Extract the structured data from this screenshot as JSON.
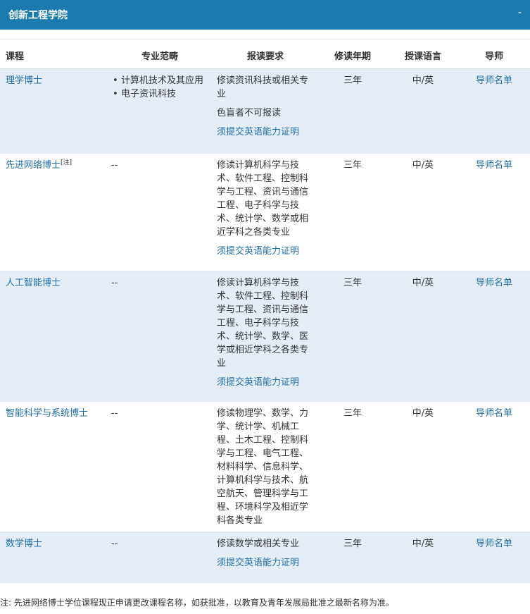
{
  "header": {
    "title": "创新工程学院",
    "toggle": "-"
  },
  "columns": [
    "课程",
    "专业范畴",
    "报读要求",
    "修读年期",
    "授课语言",
    "导师"
  ],
  "rows": [
    {
      "program": "理学博士",
      "note_mark": "",
      "fields": [
        "计算机技术及其应用",
        "电子资讯科技"
      ],
      "field_dash": "",
      "requirements": [
        "修读资讯科技或相关专业",
        "色盲者不可报读"
      ],
      "english_link": "须提交英语能力证明",
      "years": "三年",
      "language": "中/英",
      "supervisor": "导师名单"
    },
    {
      "program": "先进网络博士",
      "note_mark": "[注]",
      "fields": [],
      "field_dash": "--",
      "requirements": [
        "修读计算机科学与技术、软件工程、控制科学与工程、资讯与通信工程、电子科学与技术、统计学、数学或相近学科之各类专业"
      ],
      "english_link": "须提交英语能力证明",
      "years": "三年",
      "language": "中/英",
      "supervisor": "导师名单"
    },
    {
      "program": "人工智能博士",
      "note_mark": "",
      "fields": [],
      "field_dash": "--",
      "requirements": [
        "修读计算机科学与技术、软件工程、控制科学与工程、资讯与通信工程、电子科学与技术、统计学、数学、医学或相近学科之各类专业"
      ],
      "english_link": "须提交英语能力证明",
      "years": "三年",
      "language": "中/英",
      "supervisor": "导师名单"
    },
    {
      "program": "智能科学与系统博士",
      "note_mark": "",
      "fields": [],
      "field_dash": "--",
      "requirements": [
        "修读物理学、数学、力学、统计学、机械工程、土木工程、控制科学与工程、电气工程、材料科学、信息科学、计算机科学与技术、航空航天、管理科学与工程、环境科学及相近学科各类专业"
      ],
      "english_link": "",
      "years": "三年",
      "language": "中/英",
      "supervisor": "导师名单"
    },
    {
      "program": "数学博士",
      "note_mark": "",
      "fields": [],
      "field_dash": "--",
      "requirements": [
        "修读数学或相关专业"
      ],
      "english_link": "须提交英语能力证明",
      "years": "三年",
      "language": "中/英",
      "supervisor": "导师名单"
    }
  ],
  "footnote": "注: 先进网络博士学位课程现正申请更改课程名称，如获批准，以教育及青年发展局批准之最新名称为准。"
}
